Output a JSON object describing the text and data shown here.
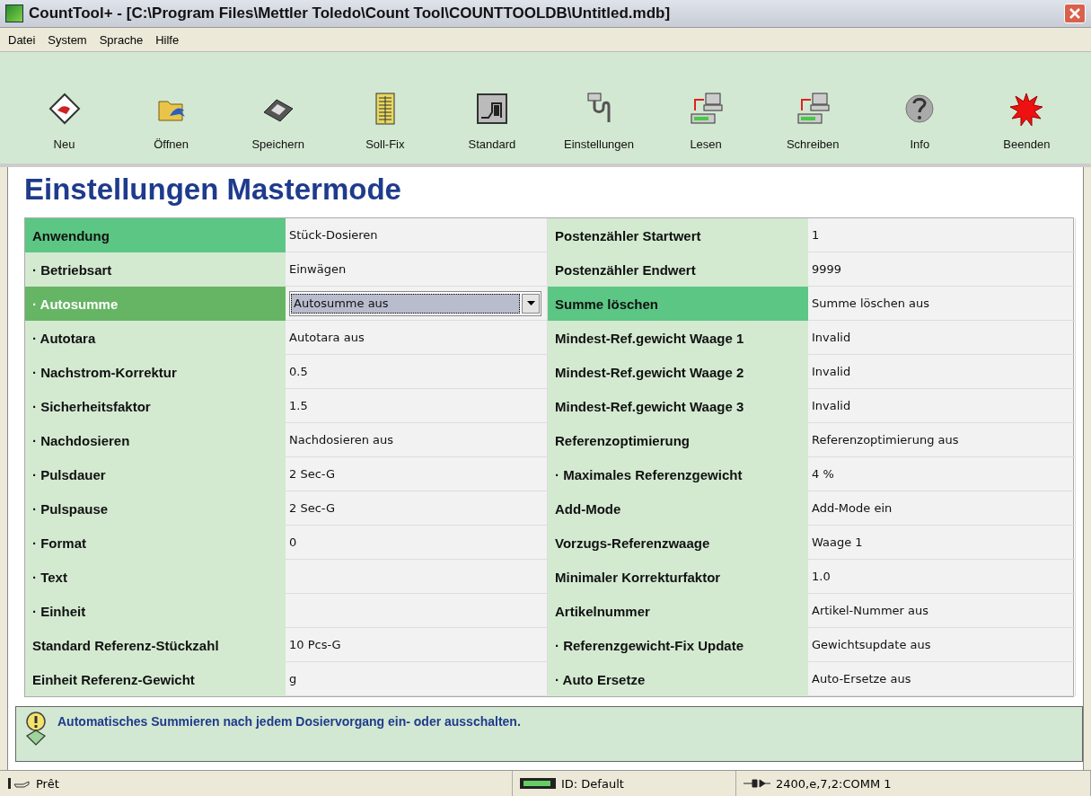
{
  "window": {
    "title": "CountTool+ - [C:\\Program Files\\Mettler Toledo\\Count Tool\\COUNTTOOLDB\\Untitled.mdb]"
  },
  "menu": [
    {
      "label": "Datei"
    },
    {
      "label": "System"
    },
    {
      "label": "Sprache"
    },
    {
      "label": "Hilfe"
    }
  ],
  "toolbar": [
    {
      "label": "Neu"
    },
    {
      "label": "Öffnen"
    },
    {
      "label": "Speichern"
    },
    {
      "label": "Soll-Fix"
    },
    {
      "label": "Standard"
    },
    {
      "label": "Einstellungen"
    },
    {
      "label": "Lesen"
    },
    {
      "label": "Schreiben"
    },
    {
      "label": "Info"
    },
    {
      "label": "Beenden"
    }
  ],
  "heading": "Einstellungen Mastermode",
  "settings": {
    "left": [
      {
        "label": "Anwendung",
        "value": "Stück-Dosieren",
        "kind": "text",
        "highlighted": true,
        "selected": false
      },
      {
        "label": "· Betriebsart",
        "value": "Einwägen",
        "kind": "text",
        "highlighted": false,
        "selected": false
      },
      {
        "label": "· Autosumme",
        "value": "Autosumme aus",
        "kind": "dropdown",
        "highlighted": false,
        "selected": true
      },
      {
        "label": "· Autotara",
        "value": "Autotara aus",
        "kind": "text",
        "highlighted": false,
        "selected": false
      },
      {
        "label": "· Nachstrom-Korrektur",
        "value": "0.5",
        "kind": "text",
        "highlighted": false,
        "selected": false
      },
      {
        "label": "· Sicherheitsfaktor",
        "value": "1.5",
        "kind": "text",
        "highlighted": false,
        "selected": false
      },
      {
        "label": "· Nachdosieren",
        "value": "Nachdosieren aus",
        "kind": "text",
        "highlighted": false,
        "selected": false
      },
      {
        "label": "· Pulsdauer",
        "value": "2 Sec-G",
        "kind": "text",
        "highlighted": false,
        "selected": false
      },
      {
        "label": "· Pulspause",
        "value": "2 Sec-G",
        "kind": "text",
        "highlighted": false,
        "selected": false
      },
      {
        "label": "· Format",
        "value": "0",
        "kind": "text",
        "highlighted": false,
        "selected": false
      },
      {
        "label": "· Text",
        "kind": "text",
        "highlighted": false,
        "selected": false
      },
      {
        "label": "· Einheit",
        "kind": "text",
        "highlighted": false,
        "selected": false
      },
      {
        "label": "Standard Referenz-Stückzahl",
        "value": "10 Pcs-G",
        "kind": "text",
        "highlighted": false,
        "selected": false
      },
      {
        "label": "Einheit Referenz-Gewicht",
        "value": "g",
        "kind": "text",
        "highlighted": false,
        "selected": false
      }
    ],
    "right": [
      {
        "label": "Postenzähler Startwert",
        "value": "1",
        "kind": "text",
        "highlighted": false,
        "selected": false
      },
      {
        "label": "Postenzähler Endwert",
        "value": "9999",
        "kind": "text",
        "highlighted": false,
        "selected": false
      },
      {
        "label": "Summe löschen",
        "value": "Summe löschen aus",
        "kind": "text",
        "highlighted": true,
        "selected": false
      },
      {
        "label": "Mindest-Ref.gewicht Waage 1",
        "value": "Invalid",
        "kind": "text",
        "highlighted": false,
        "selected": false
      },
      {
        "label": "Mindest-Ref.gewicht Waage 2",
        "value": "Invalid",
        "kind": "text",
        "highlighted": false,
        "selected": false
      },
      {
        "label": "Mindest-Ref.gewicht Waage 3",
        "value": "Invalid",
        "kind": "text",
        "highlighted": false,
        "selected": false
      },
      {
        "label": "Referenzoptimierung",
        "value": "Referenzoptimierung aus",
        "kind": "text",
        "highlighted": false,
        "selected": false
      },
      {
        "label": "· Maximales Referenzgewicht",
        "value": "4 %",
        "kind": "text",
        "highlighted": false,
        "selected": false
      },
      {
        "label": "Add-Mode",
        "value": "Add-Mode ein",
        "kind": "text",
        "highlighted": false,
        "selected": false
      },
      {
        "label": "Vorzugs-Referenzwaage",
        "value": "Waage 1",
        "kind": "text",
        "highlighted": false,
        "selected": false
      },
      {
        "label": "Minimaler Korrekturfaktor",
        "value": "1.0",
        "kind": "text",
        "highlighted": false,
        "selected": false
      },
      {
        "label": "Artikelnummer",
        "value": "Artikel-Nummer aus",
        "kind": "text",
        "highlighted": false,
        "selected": false
      },
      {
        "label": "· Referenzgewicht-Fix Update",
        "value": "Gewichtsupdate aus",
        "kind": "text",
        "highlighted": false,
        "selected": false
      },
      {
        "label": "· Auto Ersetze",
        "value": "Auto-Ersetze aus",
        "kind": "text",
        "highlighted": false,
        "selected": false
      }
    ]
  },
  "hint": "Automatisches Summieren nach jedem Dosiervorgang ein- oder ausschalten.",
  "status_bar": [
    {
      "text": "Prêt"
    },
    {
      "text": "ID: Default"
    },
    {
      "text": "2400,e,7,2:COMM 1"
    }
  ]
}
